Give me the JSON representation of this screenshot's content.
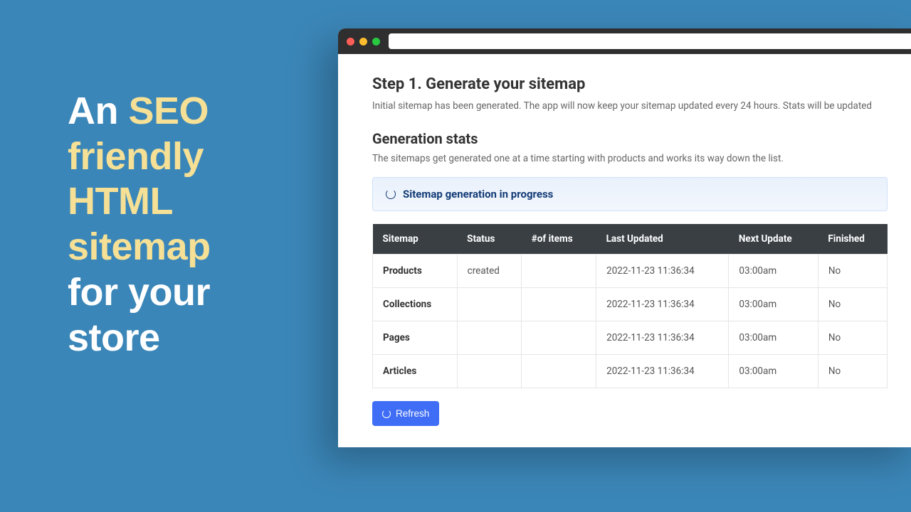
{
  "hero": {
    "line1_a": "An ",
    "line1_b": "SEO",
    "line2": "friendly",
    "line3_a": "HTML",
    "line4_a": "sitemap",
    "line5": "for your",
    "line6": "store"
  },
  "page": {
    "step_title": "Step 1. Generate your sitemap",
    "step_desc": "Initial sitemap has been generated. The app will now keep your sitemap updated every 24 hours. Stats will be updated",
    "section_title": "Generation stats",
    "section_desc": "The sitemaps get generated one at a time starting with products and works its way down the list.",
    "progress_label": "Sitemap generation in progress",
    "refresh_label": "Refresh"
  },
  "table": {
    "headers": {
      "sitemap": "Sitemap",
      "status": "Status",
      "items": "#of items",
      "last_updated": "Last Updated",
      "next_update": "Next Update",
      "finished": "Finished"
    },
    "rows": [
      {
        "name": "Products",
        "status": "created",
        "items": "",
        "last_updated": "2022-11-23 11:36:34",
        "next_update": "03:00am",
        "finished": "No"
      },
      {
        "name": "Collections",
        "status": "",
        "items": "",
        "last_updated": "2022-11-23 11:36:34",
        "next_update": "03:00am",
        "finished": "No"
      },
      {
        "name": "Pages",
        "status": "",
        "items": "",
        "last_updated": "2022-11-23 11:36:34",
        "next_update": "03:00am",
        "finished": "No"
      },
      {
        "name": "Articles",
        "status": "",
        "items": "",
        "last_updated": "2022-11-23 11:36:34",
        "next_update": "03:00am",
        "finished": "No"
      }
    ]
  }
}
